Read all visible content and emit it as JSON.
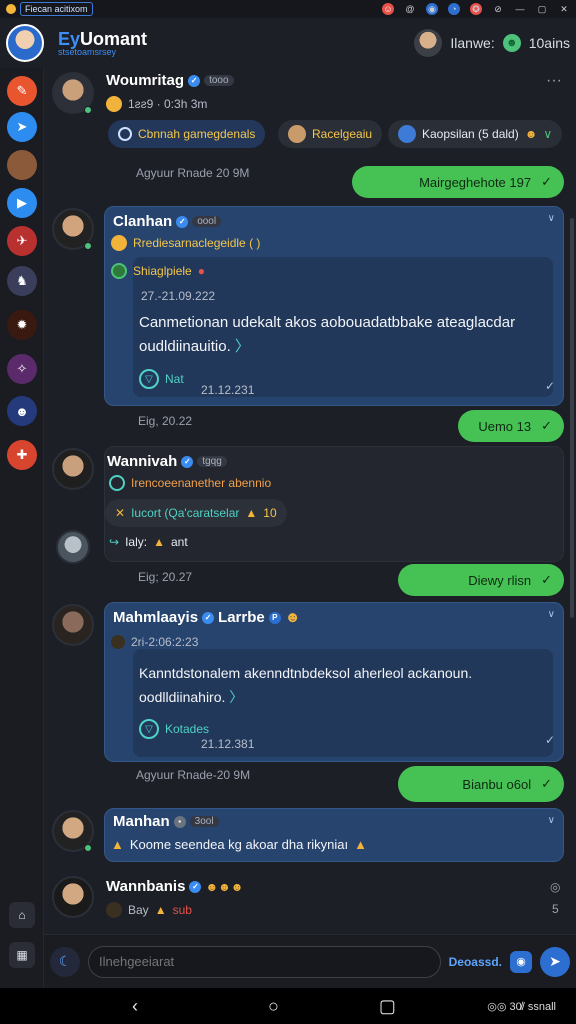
{
  "statusbar": {
    "badge": "Fiecan acitixom",
    "icons": [
      "☺",
      "@",
      "◉",
      "◔",
      "✪",
      "⊘"
    ],
    "window_controls": [
      "—",
      "▢",
      "✕"
    ]
  },
  "header": {
    "title_prefix": "Ey",
    "title": "Uomant",
    "subtitle": "stsetoamsrsey",
    "user_name": "Ilanwe:",
    "status_label": "10ains"
  },
  "sidebar": {
    "items": [
      "a",
      "b",
      "c",
      "d",
      "e",
      "f",
      "g",
      "h",
      "i",
      "j"
    ]
  },
  "messages": {
    "m1": {
      "name": "Woumritag",
      "tag": "tooo",
      "sub": "1ƨƨ9 · 0:3h 3m",
      "chips": [
        "Cbnnah gamegdenals",
        "Racelgeaiu",
        "Kaopsilan (5 dald)"
      ]
    },
    "o1": {
      "stamp": "Agyuur Rnade  20 9M",
      "text": "Mairgeghehote 197"
    },
    "m2": {
      "name": "Clanhan",
      "tag": "oool",
      "l1": "Rrediesarnaclegeidle ( )",
      "l2": "Shiaglpiele",
      "l3": "27.-21.09.222",
      "body1": "Canmetionan udekalt akos aobouadatbbake ateaglacdar",
      "body2": "oudldiinauitio.",
      "foot_label": "Nat",
      "foot_num": "21.12.231"
    },
    "o2": {
      "stamp": "Eig,  20.22",
      "text": "Uemo 13"
    },
    "m3": {
      "name": "Wannivah",
      "tag": "tgqg",
      "l1": "Irencoeenanether abennio",
      "l2": "Iucort (Qa'caratselar",
      "l2_num": "10",
      "reply_text": "Ialy:",
      "reply_tail": "ant"
    },
    "o3": {
      "stamp": "Eig;  20.27",
      "text": "Diewy rlisn"
    },
    "m4": {
      "name": "Mahmlaayis",
      "name2": "Larrbe",
      "l1": "2ri-2:06:2:23",
      "body1": "Kanntdstonalem akenndtnbdeksol aherleol ackanoun.",
      "body2": "oodlldiinahiro.",
      "foot_label": "Kotades",
      "foot_num": "21.12.381"
    },
    "o4": {
      "stamp": "Agyuur Rnade-20 9M",
      "text": "Bianbu o6ol"
    },
    "m5": {
      "name": "Manhan",
      "tag": "3ool",
      "text": "Koome seendea kg akoar dha rikyniaı"
    },
    "m6": {
      "name": "Wannbanis",
      "sub_a": "Bay",
      "sub_b": "sub"
    }
  },
  "composer": {
    "placeholder": "Ilnehgeeiarat",
    "send_label": "Deoassd."
  },
  "navbar": {
    "sys": "◎◎ 30̸/ ssnall"
  }
}
